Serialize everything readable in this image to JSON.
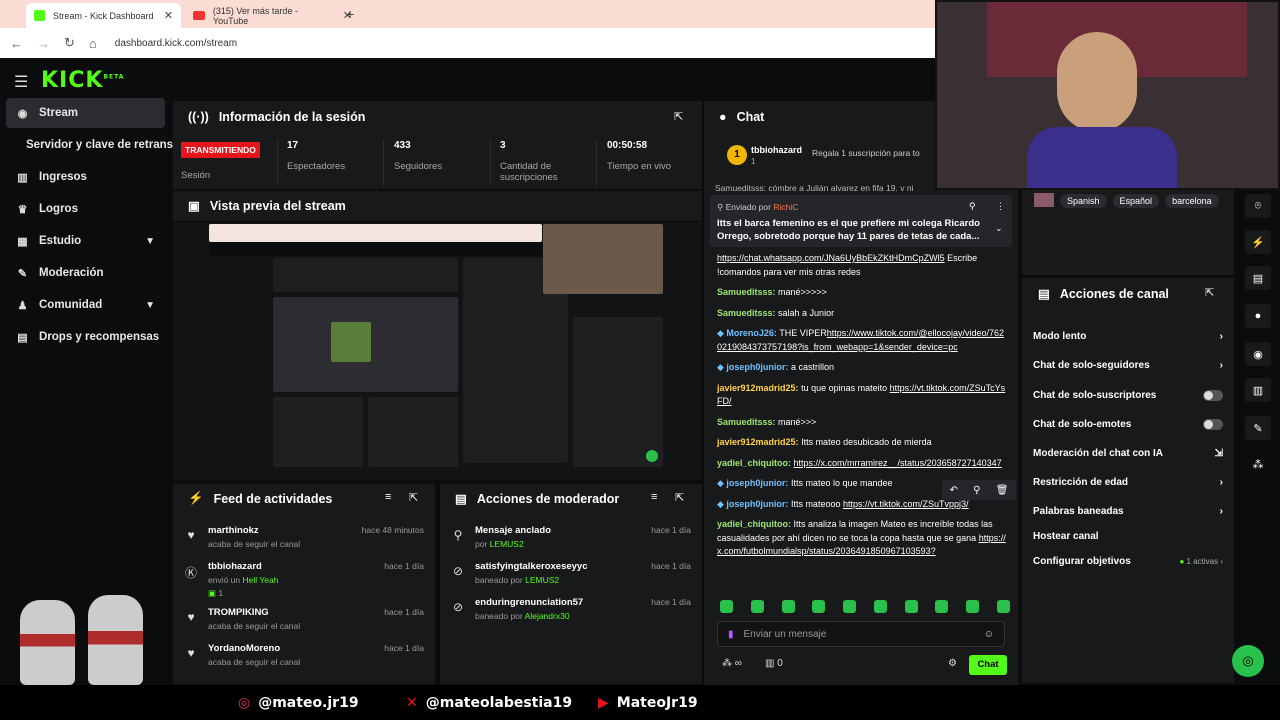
{
  "browser": {
    "tabs": [
      {
        "title": "Stream - Kick Dashboard"
      },
      {
        "title": "(315) Ver más tarde - YouTube"
      }
    ],
    "url": "dashboard.kick.com/stream"
  },
  "sidebar": {
    "items": [
      {
        "label": "Stream",
        "icon": "signal-icon"
      },
      {
        "label": "Servidor y clave de retransm",
        "icon": ""
      },
      {
        "label": "Ingresos",
        "icon": "chart-icon"
      },
      {
        "label": "Logros",
        "icon": "trophy-icon"
      },
      {
        "label": "Estudio",
        "icon": "grid-icon"
      },
      {
        "label": "Moderación",
        "icon": "wrench-icon"
      },
      {
        "label": "Comunidad",
        "icon": "users-icon"
      },
      {
        "label": "Drops y recompensas",
        "icon": "gift-icon"
      }
    ]
  },
  "session": {
    "title": "Información de la sesión",
    "status": "TRANSMITIENDO",
    "status_label": "Sesión",
    "stats": [
      {
        "value": "17",
        "label": "Espectadores"
      },
      {
        "value": "433",
        "label": "Seguidores"
      },
      {
        "value": "3",
        "label": "Cantidad de suscripciones"
      },
      {
        "value": "00:50:58",
        "label": "Tiempo en vivo"
      }
    ]
  },
  "preview": {
    "title": "Vista previa del stream"
  },
  "feed": {
    "title": "Feed de actividades",
    "items": [
      {
        "name": "marthinokz",
        "sub": "acaba de seguir el canal",
        "time": "hace 48 minutos",
        "icon": "heart-icon"
      },
      {
        "name": "tbbiohazard",
        "sub": "envió un",
        "sub2": "Hell Yeah",
        "extra": "1",
        "time": "hace 1 día",
        "icon": "kick-icon"
      },
      {
        "name": "TROMPIKING",
        "sub": "acaba de seguir el canal",
        "time": "hace 1 día",
        "icon": "heart-icon"
      },
      {
        "name": "YordanoMoreno",
        "sub": "acaba de seguir el canal",
        "time": "hace 1 día",
        "icon": "heart-icon"
      }
    ]
  },
  "modactions": {
    "title": "Acciones de moderador",
    "items": [
      {
        "name": "Mensaje anclado",
        "by": "por",
        "who": "LEMUS2",
        "time": "hace 1 día",
        "icon": "pin-icon"
      },
      {
        "name": "satisfyingtalkeroxeseyyc",
        "by": "baneado por",
        "who": "LEMUS2",
        "time": "hace 1 día",
        "icon": "ban-icon"
      },
      {
        "name": "enduringrenunciation57",
        "by": "baneado por",
        "who": "Alejandrx30",
        "time": "hace 1 día",
        "icon": "ban-icon"
      }
    ]
  },
  "chat": {
    "title": "Chat",
    "top_user": "tbbiohazard",
    "top_count": "1",
    "gift_text": "Regala 1 suscripción para to",
    "pinned_by": "Enviado por",
    "pinned_user": "RichiC",
    "pinned_text": "Itts el barca femenino es el que prefiere mi colega Ricardo Orrego, sobretodo porque hay 11 pares de tetas de cada...",
    "clipped_line": "Samueditsss: cómbre a Julián alvarez en fifa 19. v ni",
    "messages": [
      {
        "user": "",
        "text": "",
        "link": "https://chat.whatsapp.com/JNa6UyBbEkZKtHDmCpZWl5",
        "after": " Escribe !comandos para ver mis otras redes",
        "color": "#fff"
      },
      {
        "user": "Samueditsss:",
        "text": " mané>>>>>",
        "color": "#9ee86f"
      },
      {
        "user": "Samueditsss:",
        "text": " salah a Junior",
        "color": "#9ee86f"
      },
      {
        "user": "MorenoJ26:",
        "text": " THE VIPER",
        "link": "https://www.tiktok.com/@ellocojay/video/7620219084373757198?is_from_webapp=1&sender_device=pc",
        "color": "#6ec1ff",
        "badge": true
      },
      {
        "user": "joseph0junior:",
        "text": " a castrillon",
        "color": "#6ec1ff",
        "badge": true
      },
      {
        "user": "javier912madrid25:",
        "text": " tu que opinas mateito ",
        "link": "https://vt.tiktok.com/ZSuTcYsFD/",
        "color": "#ffd34d"
      },
      {
        "user": "Samueditsss:",
        "text": " mané>>>",
        "color": "#9ee86f"
      },
      {
        "user": "javier912madrid25:",
        "text": " Itts mateo desubicado de mierda",
        "color": "#ffd34d"
      },
      {
        "user": "yadiel_chiquitoo:",
        "text": " ",
        "link": "https://x.com/mrramirez__/status/203658727140347",
        "color": "#9ee86f"
      },
      {
        "user": "joseph0junior:",
        "text": " Itts mateo lo que mandee",
        "color": "#6ec1ff",
        "badge": true
      },
      {
        "user": "joseph0junior:",
        "text": " Itts mateooo ",
        "link": "https://vt.tiktok.com/ZSuTvppj3/",
        "color": "#6ec1ff",
        "badge": true
      },
      {
        "user": "yadiel_chiquitoo:",
        "text": " Itts analiza la imagen Mateo es increíble todas las casualidades por ahí dicen no se toca la copa hasta que se gana ",
        "link": "https://x.com/futbolmundialsp/status/2036491850967103593?",
        "color": "#9ee86f"
      }
    ],
    "input_placeholder": "Enviar un mensaje",
    "send_label": "Chat",
    "counter": "0"
  },
  "tags": [
    "Spanish",
    "Español",
    "barcelona"
  ],
  "channel_actions": {
    "title": "Acciones de canal",
    "items": [
      {
        "label": "Modo lento",
        "right": "chevron"
      },
      {
        "label": "Chat de solo-seguidores",
        "right": "chevron"
      },
      {
        "label": "Chat de solo-suscriptores",
        "right": "toggle"
      },
      {
        "label": "Chat de solo-emotes",
        "right": "toggle"
      },
      {
        "label": "Moderación del chat con IA",
        "right": "external"
      },
      {
        "label": "Restricción de edad",
        "right": "chevron"
      },
      {
        "label": "Palabras baneadas",
        "right": "chevron"
      },
      {
        "label": "Hostear canal",
        "right": "none"
      },
      {
        "label": "Configurar objetivos",
        "right": "chevron",
        "note": "1 activas"
      }
    ]
  },
  "footer": {
    "instagram": "@mateo.jr19",
    "x": "@mateolabestia19",
    "youtube": "MateoJr19"
  },
  "colors": {
    "kick_green": "#53fc18",
    "live_red": "#e4161b"
  }
}
